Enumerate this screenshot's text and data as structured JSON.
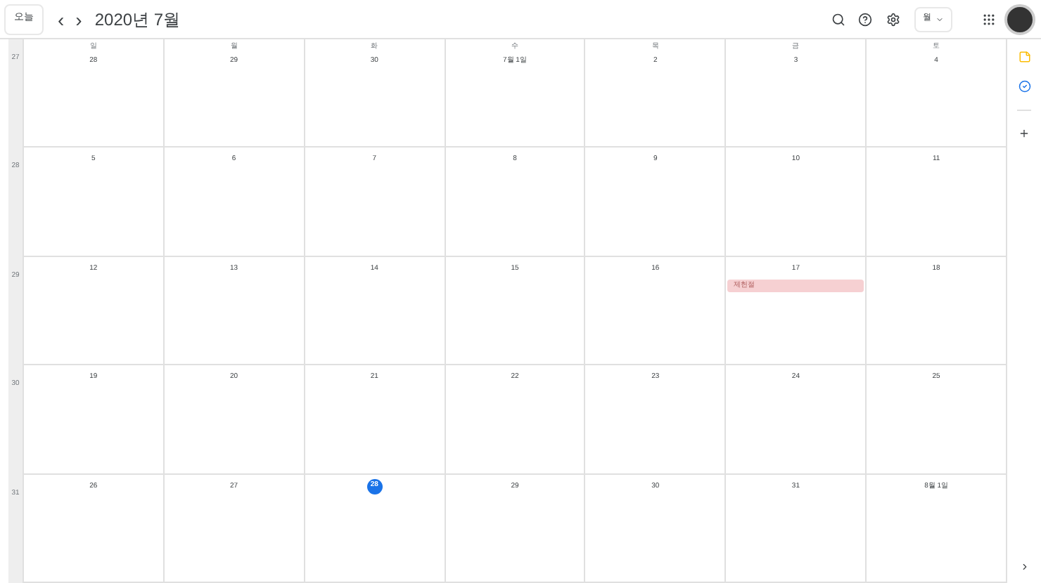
{
  "toolbar": {
    "today_button": "오늘",
    "prev": "‹",
    "next": "›",
    "title": "2020년 7월",
    "view_button": "월"
  },
  "weekdays": [
    "일",
    "월",
    "화",
    "수",
    "목",
    "금",
    "토"
  ],
  "weeks": [
    {
      "number": "27",
      "days": [
        {
          "label": "28",
          "today": false
        },
        {
          "label": "29",
          "today": false
        },
        {
          "label": "30",
          "today": false
        },
        {
          "label": "7월 1일",
          "today": false
        },
        {
          "label": "2",
          "today": false
        },
        {
          "label": "3",
          "today": false
        },
        {
          "label": "4",
          "today": false
        }
      ]
    },
    {
      "number": "28",
      "days": [
        {
          "label": "5",
          "today": false
        },
        {
          "label": "6",
          "today": false
        },
        {
          "label": "7",
          "today": false
        },
        {
          "label": "8",
          "today": false
        },
        {
          "label": "9",
          "today": false
        },
        {
          "label": "10",
          "today": false
        },
        {
          "label": "11",
          "today": false
        }
      ]
    },
    {
      "number": "29",
      "days": [
        {
          "label": "12",
          "today": false
        },
        {
          "label": "13",
          "today": false
        },
        {
          "label": "14",
          "today": false
        },
        {
          "label": "15",
          "today": false
        },
        {
          "label": "16",
          "today": false
        },
        {
          "label": "17",
          "today": false,
          "events": [
            {
              "title": "제헌절",
              "color": "#f6d0d2"
            }
          ]
        },
        {
          "label": "18",
          "today": false
        }
      ]
    },
    {
      "number": "30",
      "days": [
        {
          "label": "19",
          "today": false
        },
        {
          "label": "20",
          "today": false
        },
        {
          "label": "21",
          "today": false
        },
        {
          "label": "22",
          "today": false
        },
        {
          "label": "23",
          "today": false
        },
        {
          "label": "24",
          "today": false
        },
        {
          "label": "25",
          "today": false
        }
      ]
    },
    {
      "number": "31",
      "days": [
        {
          "label": "26",
          "today": false
        },
        {
          "label": "27",
          "today": false
        },
        {
          "label": "28",
          "today": true
        },
        {
          "label": "29",
          "today": false
        },
        {
          "label": "30",
          "today": false
        },
        {
          "label": "31",
          "today": false
        },
        {
          "label": "8월 1일",
          "today": false
        }
      ]
    }
  ]
}
